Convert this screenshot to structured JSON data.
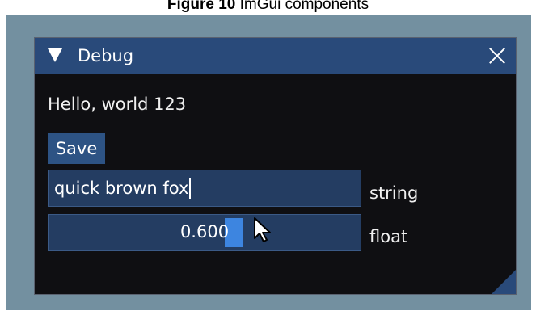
{
  "caption": {
    "bold": "Figure 10",
    "text": " ImGui components"
  },
  "window": {
    "title": "Debug",
    "text_line": "Hello, world 123",
    "save_label": "Save",
    "text_input_value": "quick brown fox",
    "text_input_label": "string",
    "slider_value": "0.600",
    "slider_fraction": 0.6,
    "slider_label": "float"
  },
  "colors": {
    "backdrop": "#7390a0",
    "window_bg": "#0f0f12",
    "title_bar": "#294a7a",
    "frame_bg": "#243d62",
    "button": "#2d5384",
    "slider_grab": "#3d85e0"
  },
  "icons": [
    "collapse-triangle-icon",
    "close-icon",
    "resize-grip-icon",
    "mouse-cursor-icon"
  ]
}
